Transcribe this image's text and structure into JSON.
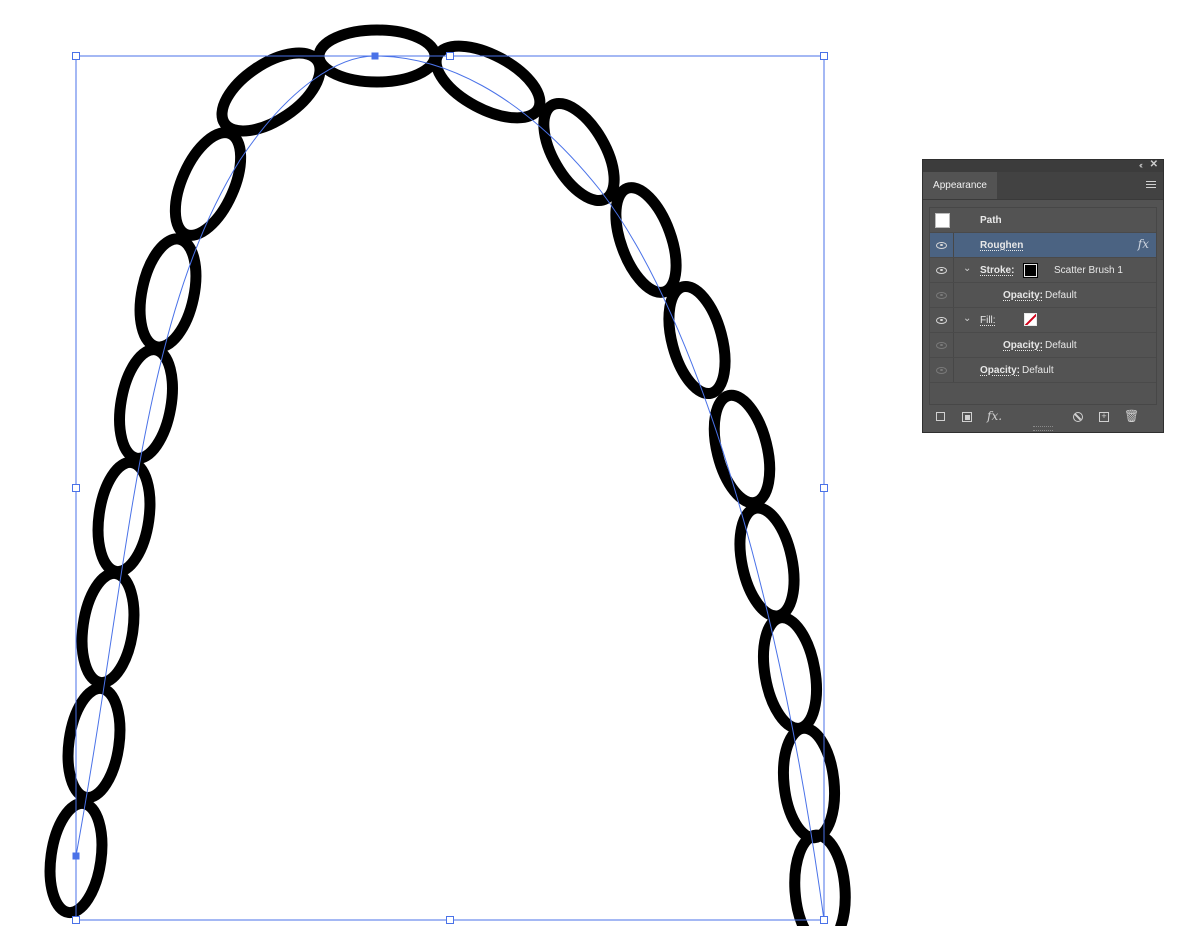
{
  "panel": {
    "collapse_glyph": "‹‹",
    "close_glyph": "✕",
    "tab_label": "Appearance",
    "rows": {
      "path": "Path",
      "roughen": "Roughen",
      "fx_mark": "fx",
      "stroke_label": "Stroke:",
      "stroke_value": "Scatter Brush 1",
      "stroke_opacity_label": "Opacity:",
      "stroke_opacity_value": "Default",
      "fill_label": "Fill:",
      "fill_opacity_label": "Opacity:",
      "fill_opacity_value": "Default",
      "opacity_label": "Opacity:",
      "opacity_value": "Default"
    },
    "footer": {
      "fx_label": "fx."
    }
  },
  "colors": {
    "selection_blue": "#4a72e8",
    "stroke": "#000000",
    "panel_bg": "#535353",
    "selected_row": "#4b6382",
    "fill_none_red": "#d0021b"
  }
}
